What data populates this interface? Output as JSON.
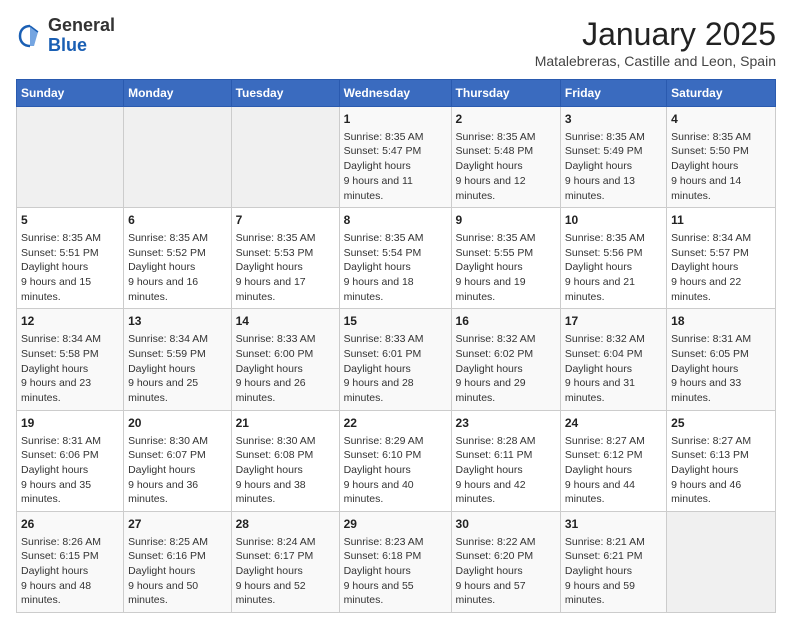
{
  "logo": {
    "general": "General",
    "blue": "Blue"
  },
  "header": {
    "month": "January 2025",
    "location": "Matalebreras, Castille and Leon, Spain"
  },
  "weekdays": [
    "Sunday",
    "Monday",
    "Tuesday",
    "Wednesday",
    "Thursday",
    "Friday",
    "Saturday"
  ],
  "weeks": [
    [
      {
        "day": "",
        "info": ""
      },
      {
        "day": "",
        "info": ""
      },
      {
        "day": "",
        "info": ""
      },
      {
        "day": "1",
        "sunrise": "8:35 AM",
        "sunset": "5:47 PM",
        "daylight": "9 hours and 11 minutes."
      },
      {
        "day": "2",
        "sunrise": "8:35 AM",
        "sunset": "5:48 PM",
        "daylight": "9 hours and 12 minutes."
      },
      {
        "day": "3",
        "sunrise": "8:35 AM",
        "sunset": "5:49 PM",
        "daylight": "9 hours and 13 minutes."
      },
      {
        "day": "4",
        "sunrise": "8:35 AM",
        "sunset": "5:50 PM",
        "daylight": "9 hours and 14 minutes."
      }
    ],
    [
      {
        "day": "5",
        "sunrise": "8:35 AM",
        "sunset": "5:51 PM",
        "daylight": "9 hours and 15 minutes."
      },
      {
        "day": "6",
        "sunrise": "8:35 AM",
        "sunset": "5:52 PM",
        "daylight": "9 hours and 16 minutes."
      },
      {
        "day": "7",
        "sunrise": "8:35 AM",
        "sunset": "5:53 PM",
        "daylight": "9 hours and 17 minutes."
      },
      {
        "day": "8",
        "sunrise": "8:35 AM",
        "sunset": "5:54 PM",
        "daylight": "9 hours and 18 minutes."
      },
      {
        "day": "9",
        "sunrise": "8:35 AM",
        "sunset": "5:55 PM",
        "daylight": "9 hours and 19 minutes."
      },
      {
        "day": "10",
        "sunrise": "8:35 AM",
        "sunset": "5:56 PM",
        "daylight": "9 hours and 21 minutes."
      },
      {
        "day": "11",
        "sunrise": "8:34 AM",
        "sunset": "5:57 PM",
        "daylight": "9 hours and 22 minutes."
      }
    ],
    [
      {
        "day": "12",
        "sunrise": "8:34 AM",
        "sunset": "5:58 PM",
        "daylight": "9 hours and 23 minutes."
      },
      {
        "day": "13",
        "sunrise": "8:34 AM",
        "sunset": "5:59 PM",
        "daylight": "9 hours and 25 minutes."
      },
      {
        "day": "14",
        "sunrise": "8:33 AM",
        "sunset": "6:00 PM",
        "daylight": "9 hours and 26 minutes."
      },
      {
        "day": "15",
        "sunrise": "8:33 AM",
        "sunset": "6:01 PM",
        "daylight": "9 hours and 28 minutes."
      },
      {
        "day": "16",
        "sunrise": "8:32 AM",
        "sunset": "6:02 PM",
        "daylight": "9 hours and 29 minutes."
      },
      {
        "day": "17",
        "sunrise": "8:32 AM",
        "sunset": "6:04 PM",
        "daylight": "9 hours and 31 minutes."
      },
      {
        "day": "18",
        "sunrise": "8:31 AM",
        "sunset": "6:05 PM",
        "daylight": "9 hours and 33 minutes."
      }
    ],
    [
      {
        "day": "19",
        "sunrise": "8:31 AM",
        "sunset": "6:06 PM",
        "daylight": "9 hours and 35 minutes."
      },
      {
        "day": "20",
        "sunrise": "8:30 AM",
        "sunset": "6:07 PM",
        "daylight": "9 hours and 36 minutes."
      },
      {
        "day": "21",
        "sunrise": "8:30 AM",
        "sunset": "6:08 PM",
        "daylight": "9 hours and 38 minutes."
      },
      {
        "day": "22",
        "sunrise": "8:29 AM",
        "sunset": "6:10 PM",
        "daylight": "9 hours and 40 minutes."
      },
      {
        "day": "23",
        "sunrise": "8:28 AM",
        "sunset": "6:11 PM",
        "daylight": "9 hours and 42 minutes."
      },
      {
        "day": "24",
        "sunrise": "8:27 AM",
        "sunset": "6:12 PM",
        "daylight": "9 hours and 44 minutes."
      },
      {
        "day": "25",
        "sunrise": "8:27 AM",
        "sunset": "6:13 PM",
        "daylight": "9 hours and 46 minutes."
      }
    ],
    [
      {
        "day": "26",
        "sunrise": "8:26 AM",
        "sunset": "6:15 PM",
        "daylight": "9 hours and 48 minutes."
      },
      {
        "day": "27",
        "sunrise": "8:25 AM",
        "sunset": "6:16 PM",
        "daylight": "9 hours and 50 minutes."
      },
      {
        "day": "28",
        "sunrise": "8:24 AM",
        "sunset": "6:17 PM",
        "daylight": "9 hours and 52 minutes."
      },
      {
        "day": "29",
        "sunrise": "8:23 AM",
        "sunset": "6:18 PM",
        "daylight": "9 hours and 55 minutes."
      },
      {
        "day": "30",
        "sunrise": "8:22 AM",
        "sunset": "6:20 PM",
        "daylight": "9 hours and 57 minutes."
      },
      {
        "day": "31",
        "sunrise": "8:21 AM",
        "sunset": "6:21 PM",
        "daylight": "9 hours and 59 minutes."
      },
      {
        "day": "",
        "info": ""
      }
    ]
  ],
  "labels": {
    "sunrise": "Sunrise:",
    "sunset": "Sunset:",
    "daylight": "Daylight hours"
  }
}
